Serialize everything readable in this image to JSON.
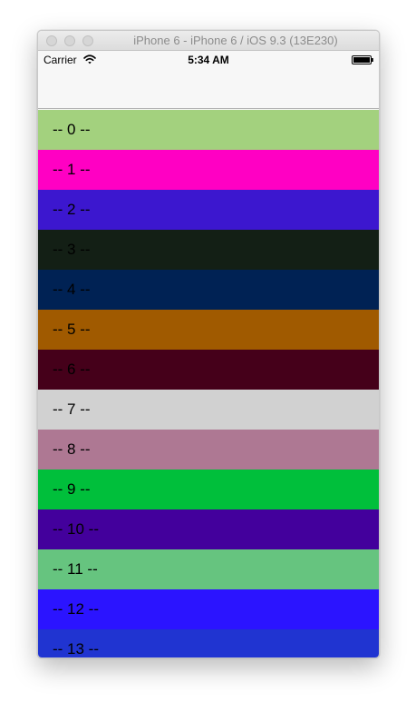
{
  "window": {
    "title": "iPhone 6 - iPhone 6 / iOS 9.3 (13E230)"
  },
  "status_bar": {
    "carrier": "Carrier",
    "time": "5:34 AM",
    "wifi_icon": "wifi-icon",
    "battery_icon": "battery-icon"
  },
  "table": {
    "rows": [
      {
        "label": "-- 0 --",
        "color": "#a3d17e"
      },
      {
        "label": "-- 1 --",
        "color": "#ff00c3"
      },
      {
        "label": "-- 2 --",
        "color": "#3c17cf"
      },
      {
        "label": "-- 3 --",
        "color": "#131f15"
      },
      {
        "label": "-- 4 --",
        "color": "#002254"
      },
      {
        "label": "-- 5 --",
        "color": "#a05a00"
      },
      {
        "label": "-- 6 --",
        "color": "#45001a"
      },
      {
        "label": "-- 7 --",
        "color": "#d1d1d1"
      },
      {
        "label": "-- 8 --",
        "color": "#ae7893"
      },
      {
        "label": "-- 9 --",
        "color": "#00bf3b"
      },
      {
        "label": "-- 10 --",
        "color": "#43009c"
      },
      {
        "label": "-- 11 --",
        "color": "#66c47f"
      },
      {
        "label": "-- 12 --",
        "color": "#2b14ff"
      },
      {
        "label": "-- 13 --",
        "color": "#2034d1"
      }
    ]
  }
}
